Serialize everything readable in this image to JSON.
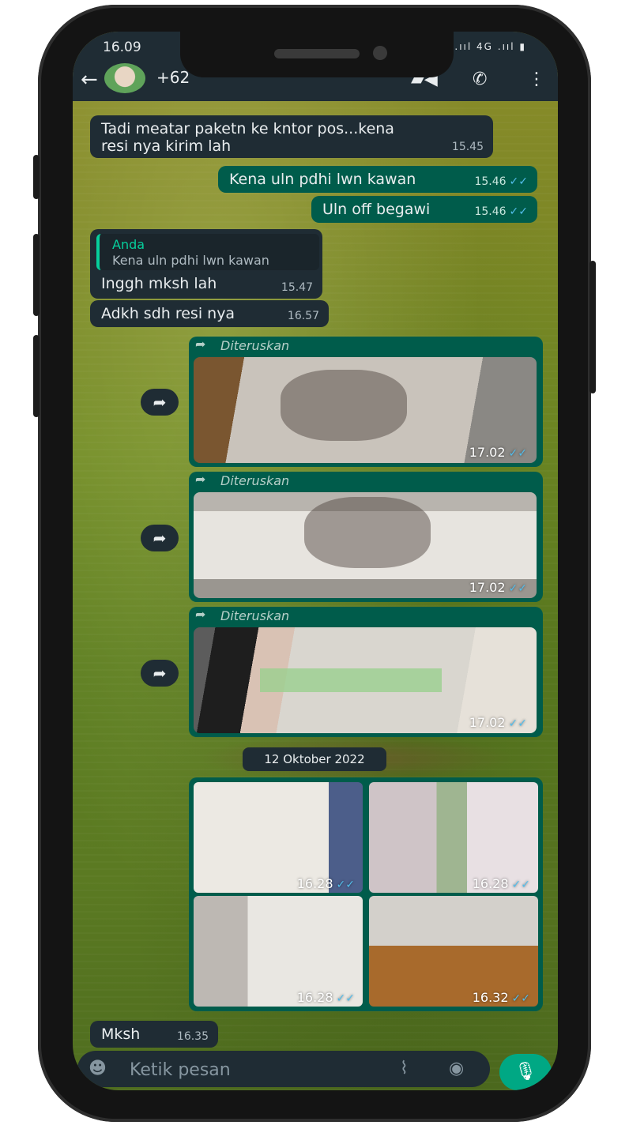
{
  "status_bar": {
    "time": "16.09",
    "icons": "▣ .ııl 4G .ııl ▮"
  },
  "header": {
    "back_icon": "←",
    "contact": "+62",
    "video_icon": "▰◀",
    "call_icon": "✆",
    "menu_icon": "⋮"
  },
  "messages": [
    {
      "dir": "in",
      "text_lines": [
        "Tadi meatar paketn ke kntor pos...kena",
        "resi nya kirim lah"
      ],
      "time": "15.45"
    },
    {
      "dir": "out",
      "text": "Kena uln pdhi lwn kawan",
      "time": "15.46",
      "ticks": "✓✓"
    },
    {
      "dir": "out",
      "text": "Uln off begawi",
      "time": "15.46",
      "ticks": "✓✓"
    },
    {
      "dir": "in",
      "quote_name": "Anda",
      "quote_text": "Kena uln pdhi lwn kawan",
      "text": "Inggh mksh lah",
      "time": "15.47"
    },
    {
      "dir": "in",
      "text": "Adkh sdh resi nya",
      "time": "16.57"
    }
  ],
  "forwarded": [
    {
      "label": "Diteruskan",
      "time": "17.02",
      "ticks": "✓✓"
    },
    {
      "label": "Diteruskan",
      "time": "17.02",
      "ticks": "✓✓"
    },
    {
      "label": "Diteruskan",
      "time": "17.02",
      "ticks": "✓✓"
    }
  ],
  "forward_icon": "➦",
  "date_chip": "12 Oktober 2022",
  "album": [
    {
      "time": "16.28",
      "ticks": "✓✓"
    },
    {
      "time": "16.28",
      "ticks": "✓✓"
    },
    {
      "time": "16.28",
      "ticks": "✓✓"
    },
    {
      "time": "16.32",
      "ticks": "✓✓"
    }
  ],
  "last_message": {
    "text": "Mksh",
    "time": "16.35"
  },
  "composer": {
    "placeholder": "Ketik pesan",
    "emoji_icon": "☻",
    "attach_icon": "⌇",
    "camera_icon": "◉",
    "mic_icon": "🎙"
  },
  "colors": {
    "bubble_in": "#1f2c34",
    "bubble_out": "#005c4b",
    "accent": "#00a884",
    "tick_read": "#53bdeb"
  }
}
